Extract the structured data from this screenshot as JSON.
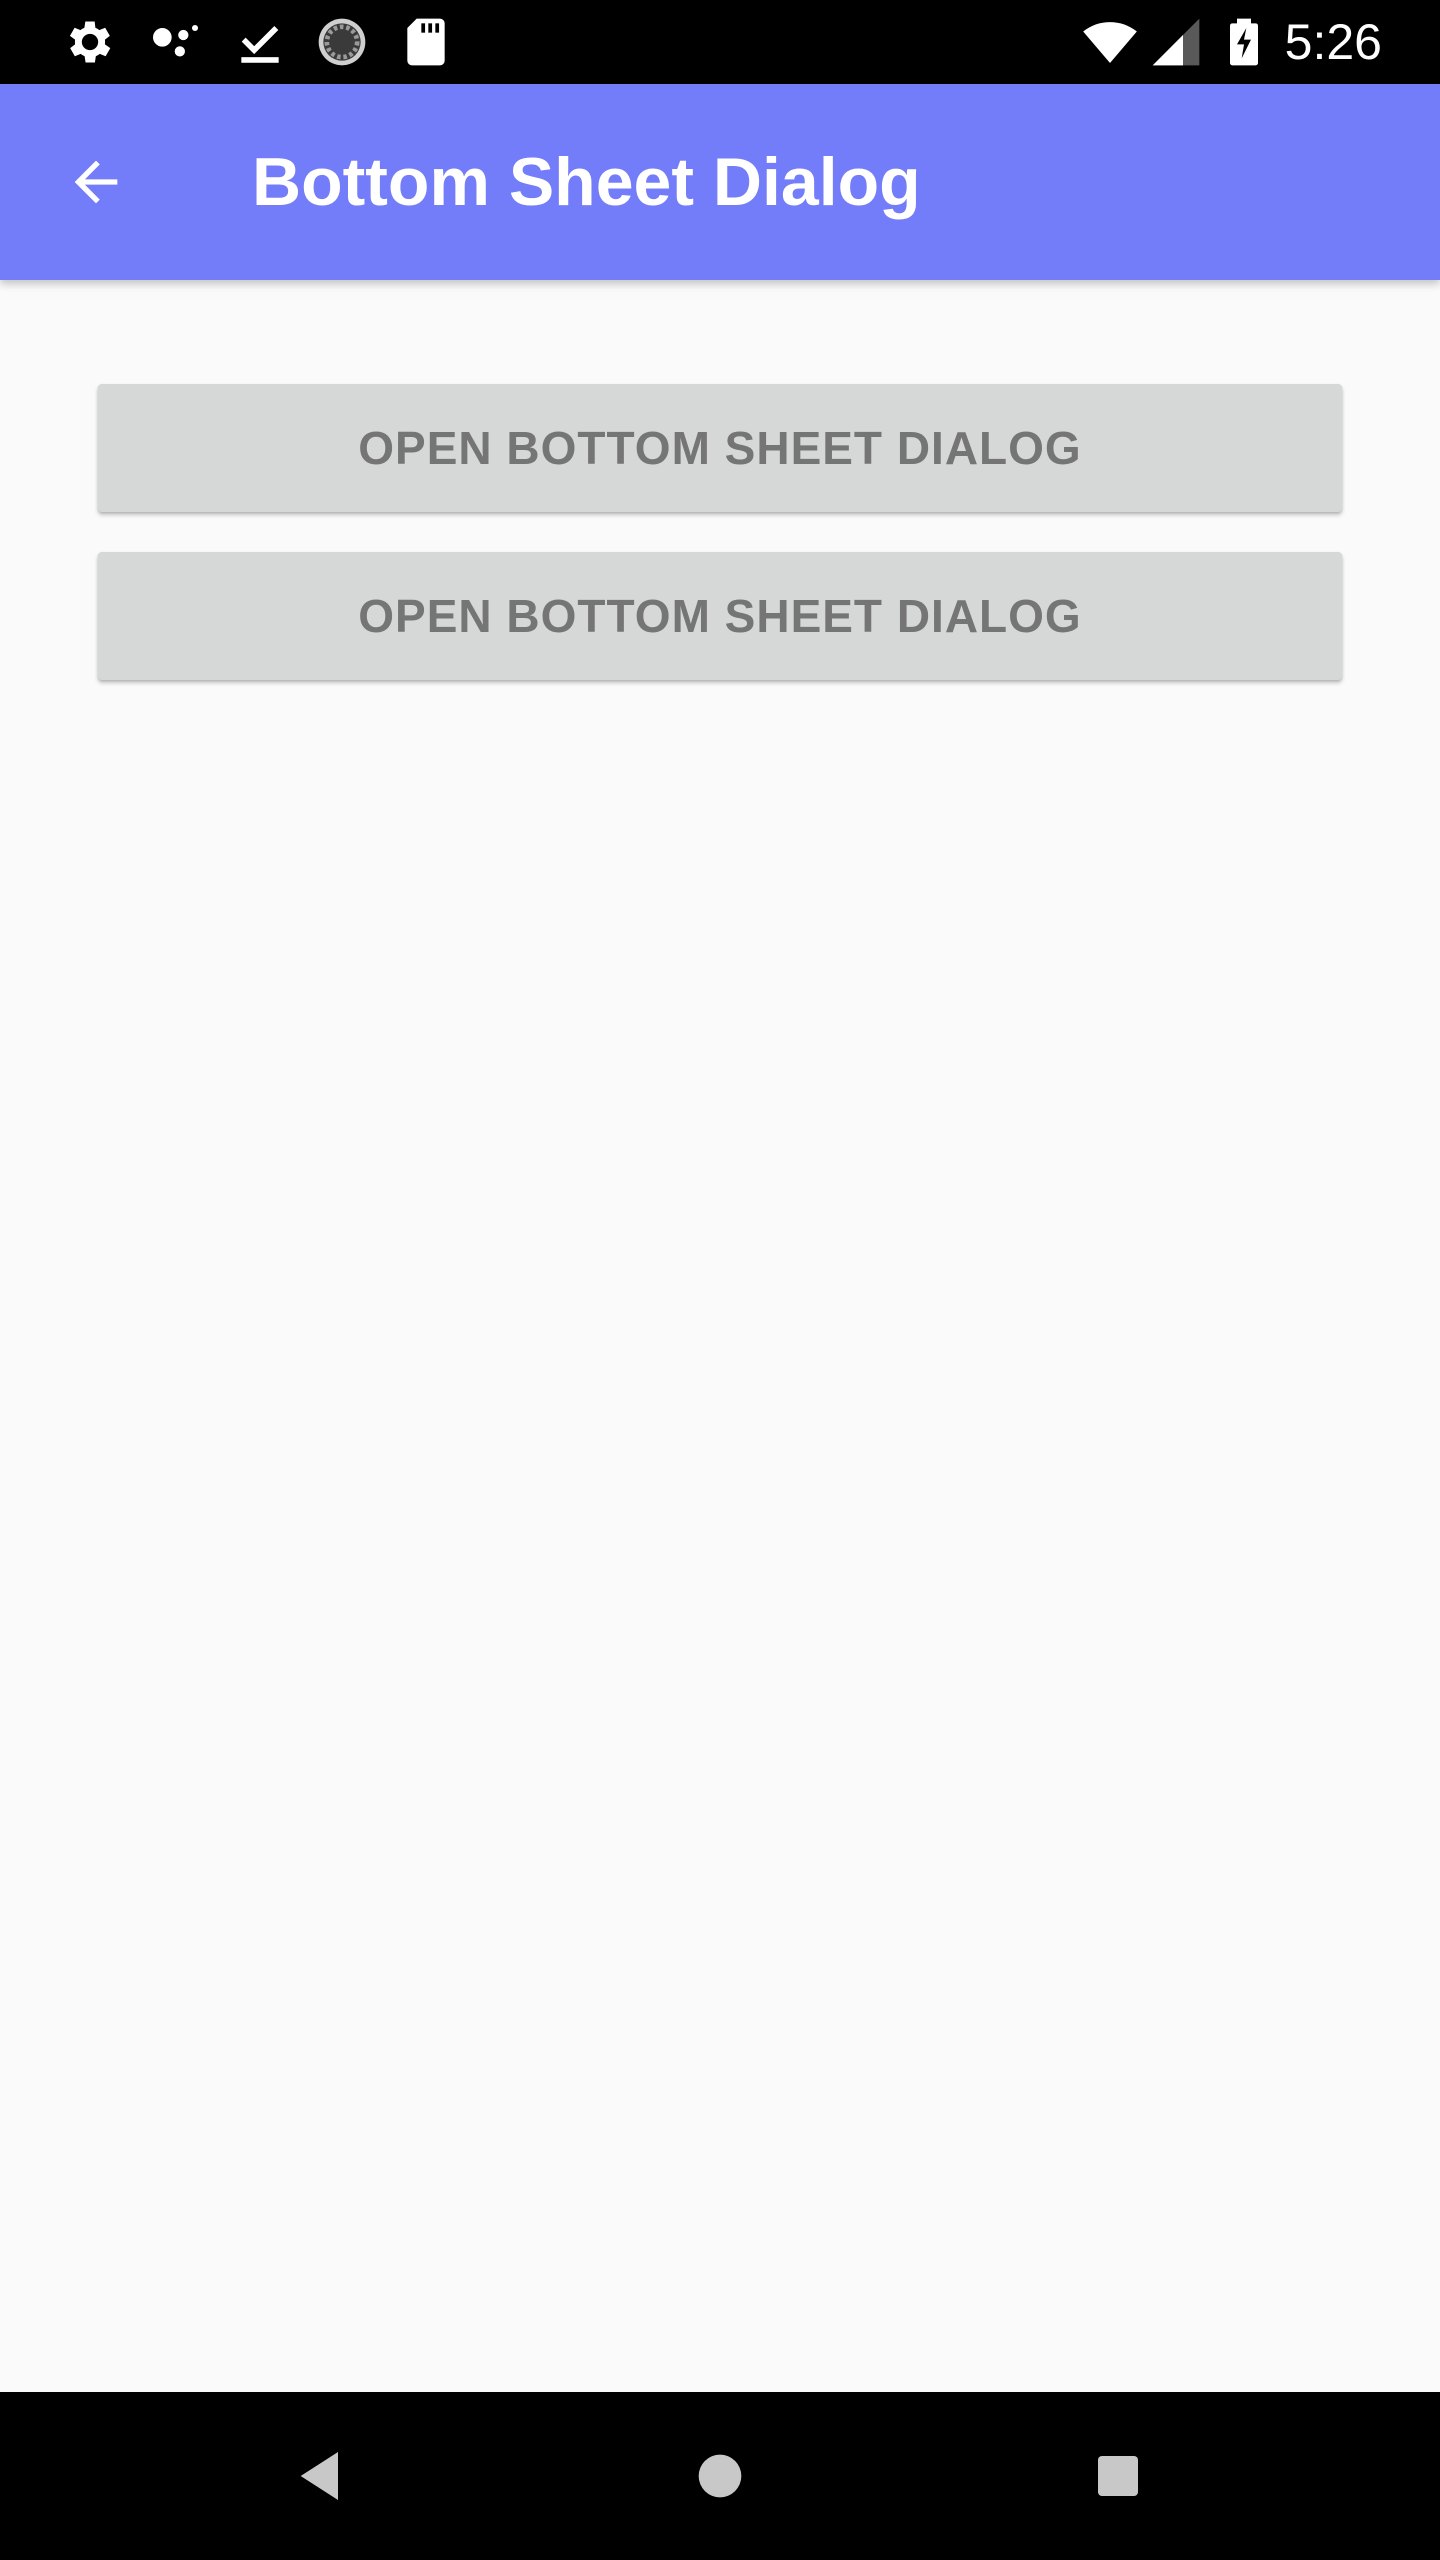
{
  "status_bar": {
    "time": "5:26",
    "left_icons": [
      "settings-icon",
      "dots-icon",
      "download-done-icon",
      "sync-icon",
      "sd-card-icon"
    ],
    "right_icons": [
      "wifi-icon",
      "signal-icon",
      "battery-charging-icon"
    ]
  },
  "app_bar": {
    "title": "Bottom Sheet Dialog",
    "back_icon": "arrow-back-icon",
    "color": "#737cf9"
  },
  "main": {
    "buttons": [
      {
        "label": "OPEN BOTTOM SHEET DIALOG"
      },
      {
        "label": "OPEN BOTTOM SHEET DIALOG"
      }
    ]
  },
  "nav_bar": {
    "icons": [
      "nav-back-icon",
      "nav-home-icon",
      "nav-recents-icon"
    ]
  },
  "colors": {
    "primary": "#737cf9",
    "button_bg": "#d6d7d7",
    "button_text": "#757575",
    "background": "#fafafa"
  }
}
